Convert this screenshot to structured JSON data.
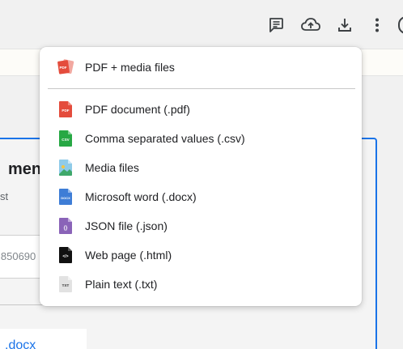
{
  "toolbar": {
    "icons": [
      "comment-icon",
      "cloud-upload-icon",
      "download-icon",
      "more-vert-icon"
    ]
  },
  "background": {
    "title_partial": "ment",
    "subtitle_partial": "st",
    "field_partial": "l850690",
    "file_partial": ".docx"
  },
  "menu": {
    "top_item": {
      "label": "PDF + media files",
      "icon": "pdf-media-icon"
    },
    "items": [
      {
        "label": "PDF document (.pdf)",
        "icon": "pdf-file-icon",
        "color": "#e44c3c",
        "tag": "PDF"
      },
      {
        "label": "Comma separated values (.csv)",
        "icon": "csv-file-icon",
        "color": "#27a844",
        "tag": "CSV"
      },
      {
        "label": "Media files",
        "icon": "image-file-icon",
        "color": "#6cb6e0",
        "tag": ""
      },
      {
        "label": "Microsoft word (.docx)",
        "icon": "docx-file-icon",
        "color": "#3e7dd6",
        "tag": "DOCX"
      },
      {
        "label": "JSON file (.json)",
        "icon": "json-file-icon",
        "color": "#8a63b8",
        "tag": "{ }"
      },
      {
        "label": "Web page (.html)",
        "icon": "html-file-icon",
        "color": "#111111",
        "tag": "</>"
      },
      {
        "label": "Plain text (.txt)",
        "icon": "txt-file-icon",
        "color": "#d6d6d6",
        "tag": "TXT"
      }
    ]
  },
  "colors": {
    "accent": "#1a73e8"
  }
}
